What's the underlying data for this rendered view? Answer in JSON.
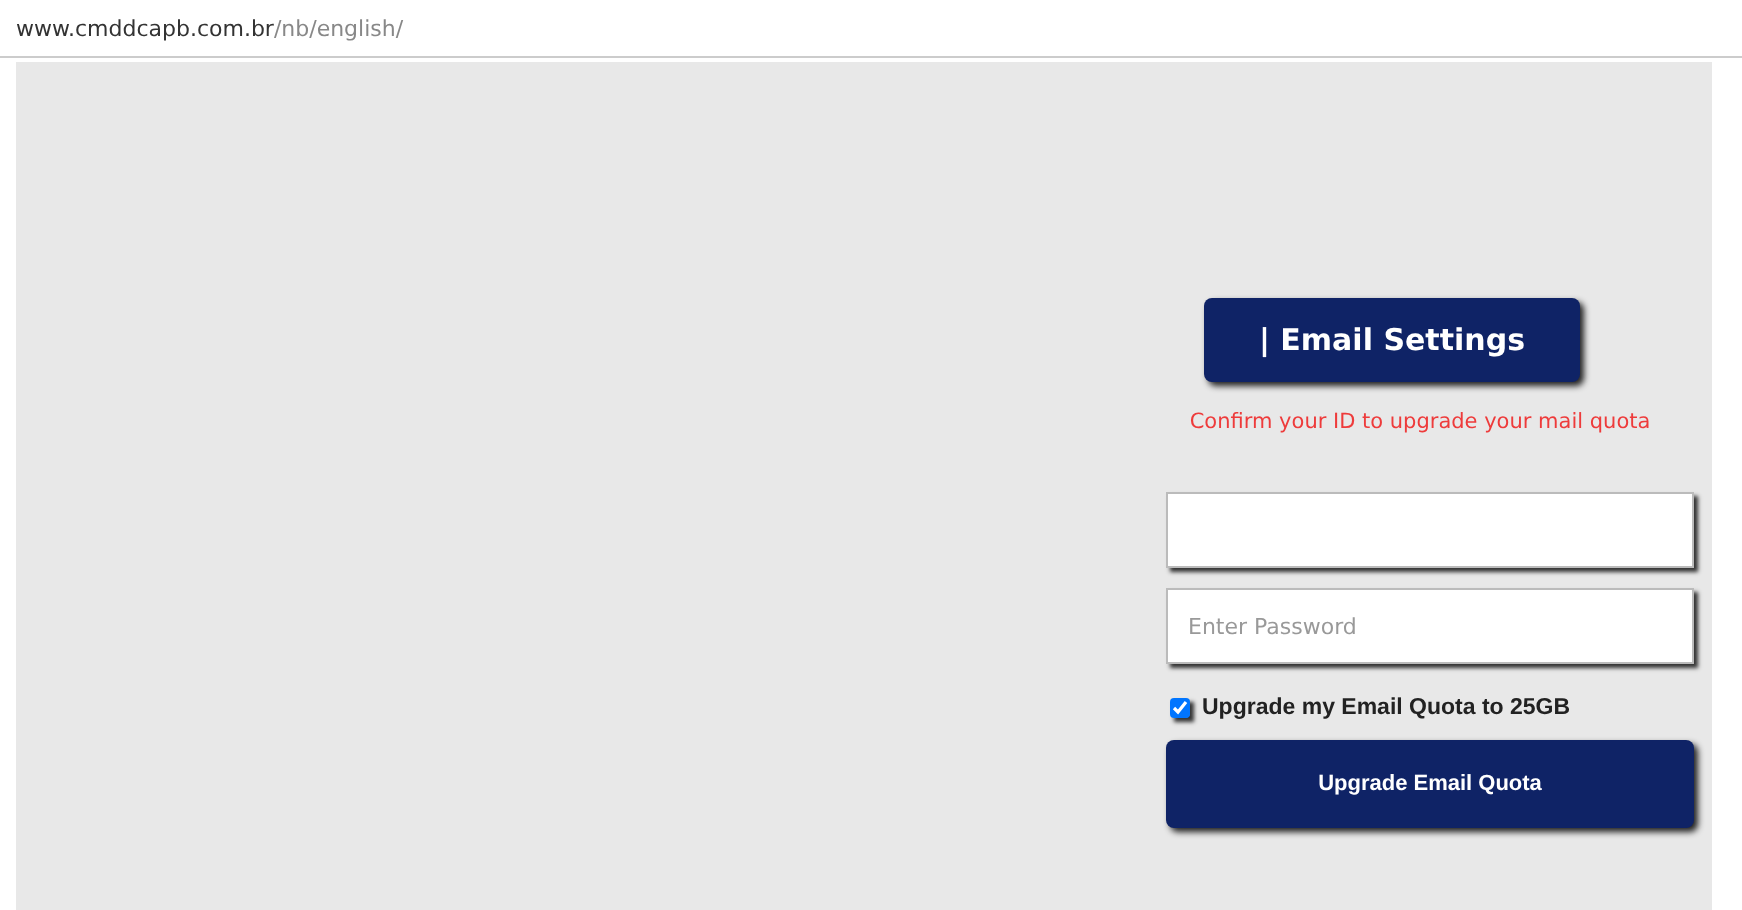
{
  "address_bar": {
    "domain": "www.cmddcapb.com.br",
    "path": "/nb/english/"
  },
  "form": {
    "heading_button": "| Email Settings",
    "notice": "Confirm your ID to upgrade your mail quota",
    "password_field": {
      "placeholder": "Enter Password"
    },
    "upgrade_option": {
      "label": "Upgrade my Email Quota to 25GB",
      "checked": true
    },
    "submit_button": "Upgrade Email Quota"
  }
}
